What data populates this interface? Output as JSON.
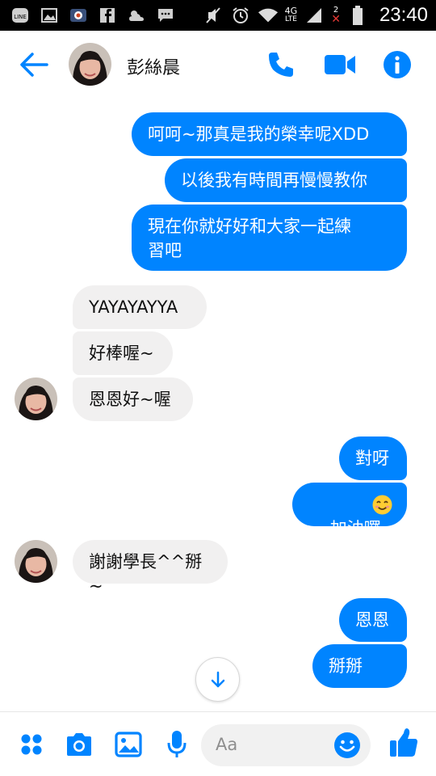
{
  "status_bar": {
    "time": "23:40",
    "network": "4G",
    "network_sub": "LTE",
    "sim_slot": "2"
  },
  "header": {
    "contact_name": "彭絲晨"
  },
  "messages": [
    {
      "from": "me",
      "text": "呵呵~那真是我的榮幸呢XDD"
    },
    {
      "from": "me",
      "text": "以後我有時間再慢慢教你"
    },
    {
      "from": "me",
      "text": "現在你就好好和大家一起練\n習吧"
    },
    {
      "from": "them",
      "text": "YAYAYAYYA"
    },
    {
      "from": "them",
      "text": "好棒喔~"
    },
    {
      "from": "them",
      "text": "恩恩好~喔"
    },
    {
      "from": "me",
      "text": "對呀"
    },
    {
      "from": "me",
      "text": "加油囉"
    },
    {
      "from": "them",
      "text": "謝謝學長^^掰~"
    },
    {
      "from": "me",
      "text": "恩恩"
    },
    {
      "from": "me",
      "text": "掰掰~~"
    }
  ],
  "composer": {
    "placeholder": "Aa"
  },
  "colors": {
    "accent": "#0084ff",
    "incoming_bubble": "#f1f0f0",
    "status_bar": "#000000"
  },
  "icons": [
    "back-arrow-icon",
    "phone-icon",
    "video-camera-icon",
    "info-icon",
    "apps-grid-icon",
    "camera-icon",
    "image-icon",
    "microphone-icon",
    "emoji-icon",
    "thumbs-up-icon",
    "arrow-down-icon",
    "smiling-emoji-icon"
  ]
}
